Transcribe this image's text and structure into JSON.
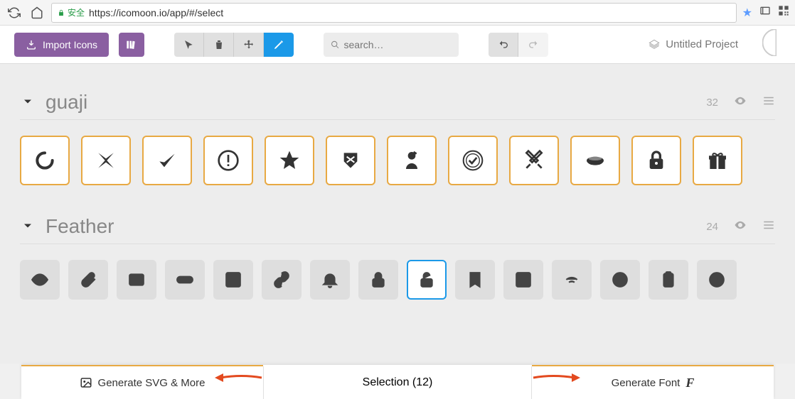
{
  "browser": {
    "secure_label": "安全",
    "url": "https://icomoon.io/app/#/select"
  },
  "toolbar": {
    "import_label": "Import Icons",
    "search_placeholder": "search…",
    "project_name": "Untitled Project"
  },
  "sets": [
    {
      "name": "guaji",
      "count": "32",
      "icons": [
        {
          "name": "spinner-icon",
          "selected": true
        },
        {
          "name": "cross-icon",
          "selected": true
        },
        {
          "name": "check-icon",
          "selected": true
        },
        {
          "name": "alert-circle-icon",
          "selected": true
        },
        {
          "name": "star-icon",
          "selected": true
        },
        {
          "name": "shield-crossed-icon",
          "selected": true
        },
        {
          "name": "user-icon",
          "selected": true
        },
        {
          "name": "checkmark-ring-icon",
          "selected": true
        },
        {
          "name": "swords-icon",
          "selected": true
        },
        {
          "name": "bowl-icon",
          "selected": true
        },
        {
          "name": "lock-icon",
          "selected": true
        },
        {
          "name": "gift-icon",
          "selected": true
        }
      ]
    },
    {
      "name": "Feather",
      "count": "24",
      "icons": [
        {
          "name": "eye-icon",
          "selected": false
        },
        {
          "name": "paperclip-icon",
          "selected": false
        },
        {
          "name": "mail-icon",
          "selected": false
        },
        {
          "name": "toggle-icon",
          "selected": false
        },
        {
          "name": "layout-icon",
          "selected": false
        },
        {
          "name": "link-icon",
          "selected": false
        },
        {
          "name": "bell-icon",
          "selected": false
        },
        {
          "name": "lock-closed-icon",
          "selected": false
        },
        {
          "name": "lock-open-icon",
          "selected": false,
          "blue": true
        },
        {
          "name": "bookmark-icon",
          "selected": false
        },
        {
          "name": "image-icon",
          "selected": false
        },
        {
          "name": "wifi-icon",
          "selected": false
        },
        {
          "name": "target-icon",
          "selected": false
        },
        {
          "name": "clipboard-icon",
          "selected": false
        },
        {
          "name": "clock-icon",
          "selected": false
        }
      ]
    }
  ],
  "bottom": {
    "svg_label": "Generate SVG & More",
    "selection_label": "Selection (12)",
    "font_label": "Generate Font"
  }
}
